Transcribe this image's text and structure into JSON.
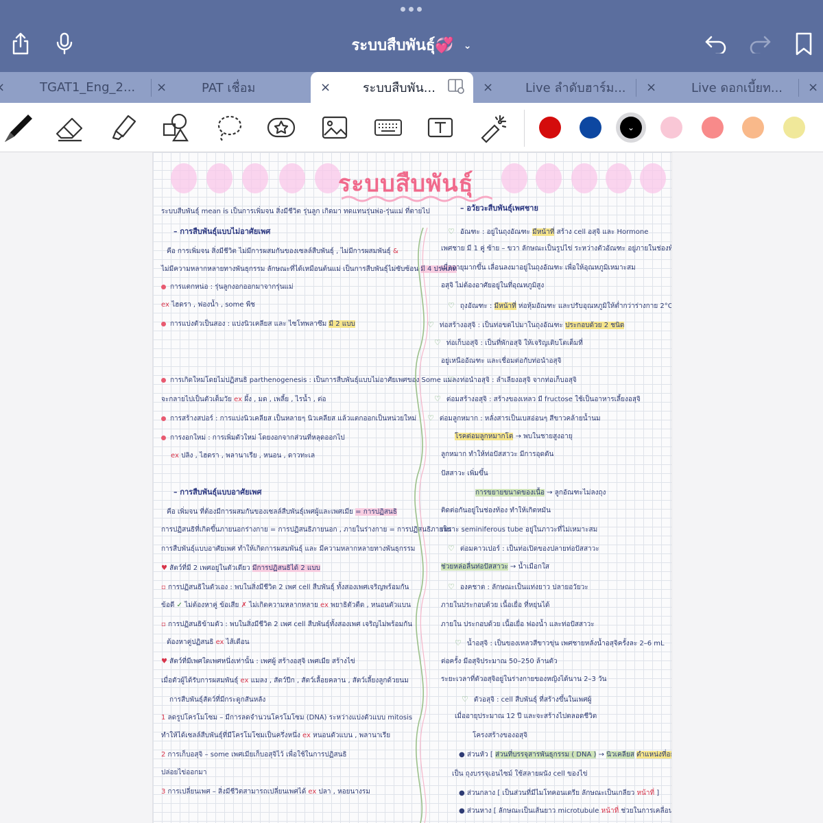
{
  "topbar": {
    "title": "ระบบสืบพันธุ์💞",
    "chevron": "chevron-down-icon"
  },
  "tabs": [
    {
      "label": "TGAT1_Eng_2...",
      "close": "×"
    },
    {
      "label": "PAT เชื่อม",
      "close": "×"
    },
    {
      "label": "ระบบสืบพัน...",
      "close": "×",
      "active": true
    },
    {
      "label": "Live ลำดับฮาร์ม...",
      "close": "×"
    },
    {
      "label": "Live ดอกเบี้ยท...",
      "close": "×"
    }
  ],
  "tab_edge_close": "×",
  "toolbar": {
    "tools": [
      "pen-tool-icon",
      "eraser-icon",
      "highlighter-icon",
      "shapes-icon",
      "lasso-icon",
      "sticker-icon",
      "image-icon",
      "keyboard-icon",
      "text-box-icon",
      "laser-pointer-icon"
    ],
    "colors": [
      "#d40c0c",
      "#0d47a1",
      "#000000",
      "#f9c7d6",
      "#f88a8a",
      "#f9b98a",
      "#f0e89a"
    ],
    "selected_color": "#000000",
    "accent": "#5b6e9e"
  },
  "note": {
    "title": "ระบบสืบพันธุ์",
    "left_heading": "ระบบสืบพันธุ์ mean is เป็นการเพิ่มจน สิ่งมีชีวิต รุ่นลูก เกิดมา ทดแทนรุ่นพ่อ-รุ่นแม่ ที่ตายไป",
    "section1": "– การสืบพันธุ์แบบไม่อาศัยเพศ",
    "section2": "– การสืบพันธุ์แบบอาศัยเพศ",
    "right_heading": "– อวัยวะสืบพันธุ์เพศชาย",
    "right_items": [
      "อัณฑะ",
      "ถุงอัณฑะ",
      "ท่อสร้างอสุจิ",
      "ท่อเก็บอสุจิ",
      "ท่อนำอสุจิ",
      "ต่อมสร้างอสุจิ",
      "ต่อมลูกหมาก",
      "ต่อมคาวเปอร์",
      "องคชาต",
      "น้ำอสุจิ",
      "ตัวอสุจิ"
    ]
  }
}
